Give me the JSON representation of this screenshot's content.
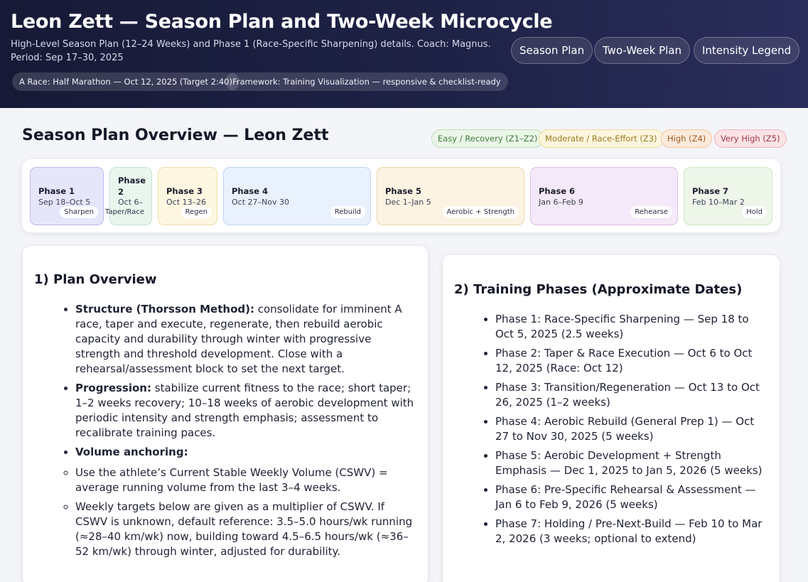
{
  "header": {
    "title": "Leon Zett — Season Plan and Two-Week Microcycle",
    "subtitle": "High-Level Season Plan (12–24 Weeks) and Phase 1 (Race-Specific Sharpening) details. Coach: Magnus. Period: Sep 17–30, 2025",
    "chips": [
      "A Race: Half Marathon — Oct 12, 2025 (Target 2:40)",
      "Framework: Training Visualization — responsive & checklist-ready"
    ],
    "nav": [
      "Season Plan",
      "Two-Week Plan",
      "Intensity Legend"
    ]
  },
  "overview": {
    "title": "Season Plan Overview — Leon Zett",
    "legend": [
      {
        "label": "Easy / Recovery (Z1–Z2)",
        "bg": "#eaf6e8",
        "border": "#bfe0b8",
        "fg": "#3f7a39"
      },
      {
        "label": "Moderate / Race-Effort (Z3)",
        "bg": "#fdf6de",
        "border": "#efdc9a",
        "fg": "#9a7a1f"
      },
      {
        "label": "High (Z4)",
        "bg": "#fdebdc",
        "border": "#f2c59f",
        "fg": "#a65a22"
      },
      {
        "label": "Very High (Z5)",
        "bg": "#fbe3e6",
        "border": "#efb6be",
        "fg": "#a33645"
      }
    ],
    "phases": [
      {
        "name": "Phase 1",
        "dates": "Sep 18–Oct 5",
        "tag": "Sharpen",
        "bg": "#e6e6fb",
        "border": "#b9b9ee"
      },
      {
        "name": "Phase 2",
        "dates": "Oct 6–",
        "tag": "Taper/Race",
        "bg": "#e9f6ee",
        "border": "#c3e3cf"
      },
      {
        "name": "Phase 3",
        "dates": "Oct 13–26",
        "tag": "Regen",
        "bg": "#fdf6e1",
        "border": "#f0dfa9"
      },
      {
        "name": "Phase 4",
        "dates": "Oct 27–Nov 30",
        "tag": "Rebuild",
        "bg": "#e9f1fd",
        "border": "#c2d5f2"
      },
      {
        "name": "Phase 5",
        "dates": "Dec 1–Jan 5",
        "tag": "Aerobic + Strength",
        "bg": "#fdf3e3",
        "border": "#f0d6ad"
      },
      {
        "name": "Phase 6",
        "dates": "Jan 6–Feb 9",
        "tag": "Rehearse",
        "bg": "#f4e9f8",
        "border": "#dcc0e8"
      },
      {
        "name": "Phase 7",
        "dates": "Feb 10–Mar 2",
        "tag": "Hold",
        "bg": "#eef6ea",
        "border": "#cfe5c6"
      }
    ]
  },
  "plan_overview": {
    "title": "1) Plan Overview",
    "items": [
      {
        "bold": "Structure (Thorsson Method):",
        "text": " consolidate for imminent A race, taper and execute, regenerate, then rebuild aerobic capacity and durability through winter with progressive strength and threshold development. Close with a rehearsal/assessment block to set the next target."
      },
      {
        "bold": "Progression:",
        "text": " stabilize current fitness to the race; short taper; 1–2 weeks recovery; 10–18 weeks of aerobic development with periodic intensity and strength emphasis; assessment to recalibrate training paces."
      },
      {
        "bold": "Volume anchoring:",
        "text": ""
      }
    ],
    "sub_items": [
      "Use the athlete’s Current Stable Weekly Volume (CSWV) = average running volume from the last 3–4 weeks.",
      "Weekly targets below are given as a multiplier of CSWV. If CSWV is unknown, default reference: 3.5–5.0 hours/wk running (≈28–40 km/wk) now, building toward 4.5–6.5 hours/wk (≈36–52 km/wk) through winter, adjusted for durability."
    ]
  },
  "training_phases": {
    "title": "2) Training Phases (Approximate Dates)",
    "items": [
      "Phase 1: Race-Specific Sharpening — Sep 18 to Oct 5, 2025 (2.5 weeks)",
      "Phase 2: Taper & Race Execution — Oct 6 to Oct 12, 2025 (Race: Oct 12)",
      "Phase 3: Transition/Regeneration — Oct 13 to Oct 26, 2025 (1–2 weeks)",
      "Phase 4: Aerobic Rebuild (General Prep 1) — Oct 27 to Nov 30, 2025 (5 weeks)",
      "Phase 5: Aerobic Development + Strength Emphasis — Dec 1, 2025 to Jan 5, 2026 (5 weeks)",
      "Phase 6: Pre-Specific Rehearsal & Assessment — Jan 6 to Feb 9, 2026 (5 weeks)",
      "Phase 7: Holding / Pre-Next-Build — Feb 10 to Mar 2, 2026 (3 weeks; optional to extend)"
    ]
  }
}
